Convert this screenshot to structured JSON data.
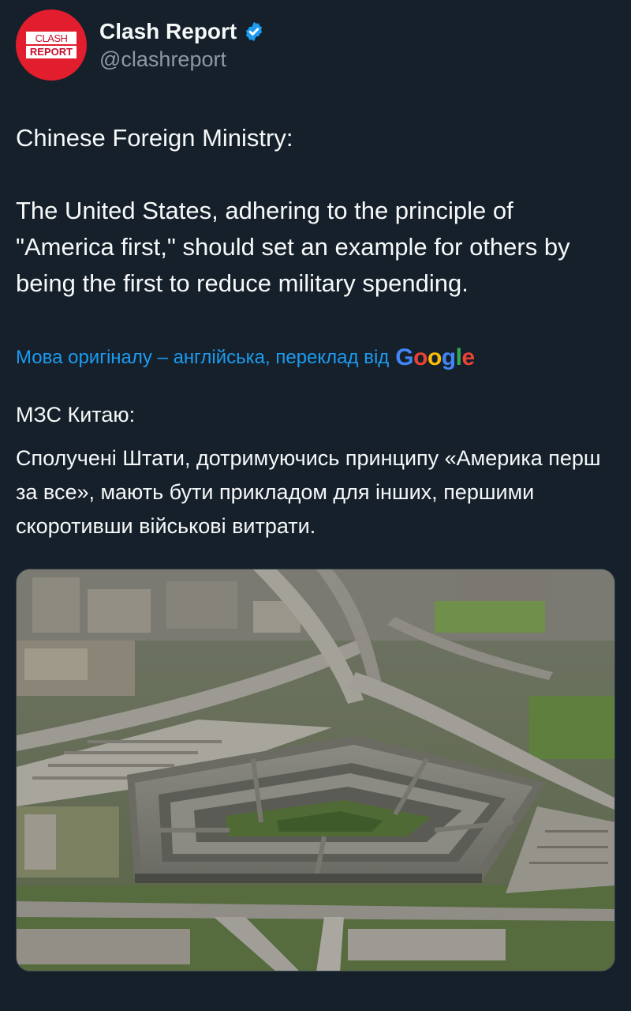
{
  "account": {
    "display_name": "Clash Report",
    "handle": "@clashreport",
    "logo_top": "CLASH",
    "logo_bottom": "REPORT",
    "verified_icon": "verified-badge-icon"
  },
  "tweet": {
    "text": [
      "Chinese Foreign Ministry:",
      "",
      "The United States, adhering to the principle of \"America first,\" should set an example for others by being the first to reduce military spending."
    ]
  },
  "translation": {
    "notice": "Мова оригіналу – англійська, переклад від",
    "provider": "Google",
    "text": [
      "МЗС Китаю:",
      "Сполучені Штати, дотримуючись принципу «Америка перш за все», мають бути прикладом для інших, першими скоротивши військові витрати."
    ]
  },
  "media": {
    "subject": "aerial-photo-pentagon"
  },
  "colors": {
    "background": "#15202b",
    "text": "#f7f9f9",
    "secondary": "#8b98a5",
    "link": "#1d9bf0",
    "brand": "#e11d2e"
  }
}
